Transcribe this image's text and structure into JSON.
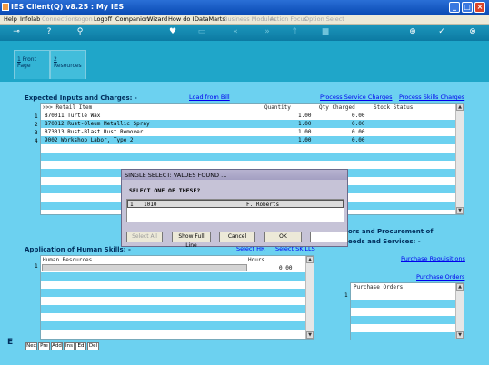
{
  "window": {
    "title": "IES Client(Q) v8.25 : My IES"
  },
  "menu": [
    {
      "label": "Help",
      "enabled": true
    },
    {
      "label": "Infolab",
      "enabled": true
    },
    {
      "label": "Connections",
      "enabled": false
    },
    {
      "label": "Logon",
      "enabled": false
    },
    {
      "label": "Logoff",
      "enabled": true
    },
    {
      "label": "Companion",
      "enabled": true
    },
    {
      "label": "Wizard",
      "enabled": true
    },
    {
      "label": "How do I",
      "enabled": true
    },
    {
      "label": "DataMarts",
      "enabled": true
    },
    {
      "label": "Business Modules",
      "enabled": false
    },
    {
      "label": "Action Focus",
      "enabled": false
    },
    {
      "label": "Option Select",
      "enabled": false
    }
  ],
  "tabs": [
    {
      "num": "1",
      "label": "Front Page"
    },
    {
      "num": "2",
      "label": "Resources"
    }
  ],
  "inputs_section": {
    "title": "Expected Inputs and Charges: -",
    "load_link": "Load from Bill",
    "service_link": "Process Service Charges",
    "skills_link": "Process Skills Charges",
    "headers": {
      "item": ">>> Retail Item",
      "qty": "Quantity",
      "qty_charged": "Qty Charged",
      "status": "Stock Status"
    },
    "rows": [
      {
        "num": "1",
        "item": "870011 Turtle Wax",
        "qty": "1.00",
        "qty_charged": "0.00"
      },
      {
        "num": "2",
        "item": "870012 Rust-Oleum Metallic Spray",
        "qty": "1.00",
        "qty_charged": "0.00"
      },
      {
        "num": "3",
        "item": "873313 Rust-Blast Rust Remover",
        "qty": "1.00",
        "qty_charged": "0.00"
      },
      {
        "num": "4",
        "item": "9002 Workshop Labor, Type 2",
        "qty": "1.00",
        "qty_charged": "0.00"
      }
    ]
  },
  "dialog": {
    "title": "SINGLE SELECT: VALUES FOUND ...",
    "prompt": "SELECT ONE OF THESE?",
    "selected_row": {
      "num": "1",
      "code": "1010",
      "name": "F. Roberts"
    },
    "buttons": {
      "select_all": "Select All",
      "full_line": "Show Full Line",
      "cancel": "Cancel",
      "ok": "OK"
    }
  },
  "human_section": {
    "title": "Application of Human Skills: -",
    "select_hr": "Select HR",
    "select_skills": "Select SKILLS",
    "headers": {
      "hr": "Human Resources",
      "hours": "Hours"
    },
    "row": {
      "num": "1",
      "hours": "0.00"
    }
  },
  "procurement": {
    "title_line1": "ors and Procurement of",
    "title_line2": "eeds and Services: -",
    "purchase_requisitions": "Purchase Requisitions",
    "purchase_orders_link": "Purchase Orders",
    "header": "Purchase Orders",
    "row_num": "1"
  },
  "nav_buttons": [
    "Nex",
    "Pre",
    "Add",
    "Ins",
    "Ed",
    "Del"
  ],
  "side_letter": "E"
}
